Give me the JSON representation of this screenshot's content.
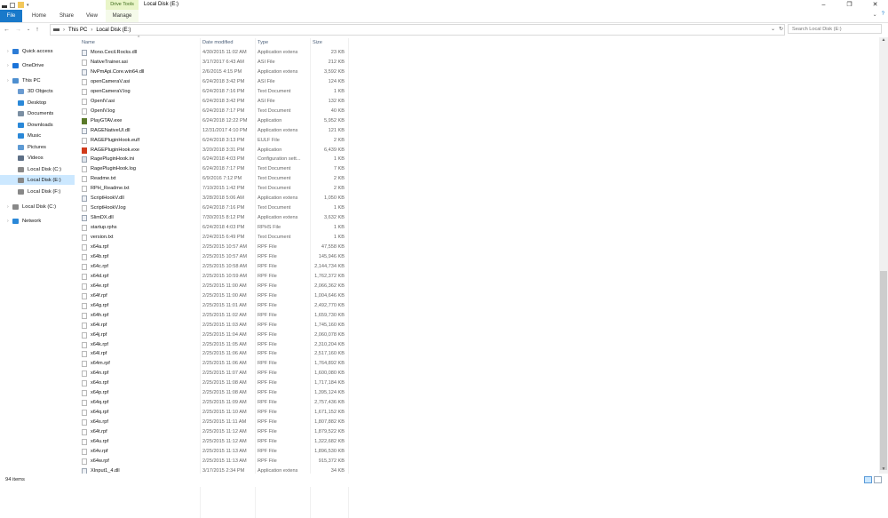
{
  "window": {
    "title": "Local Disk (E:)",
    "context_tab": "Drive Tools",
    "controls": [
      "–",
      "❐",
      "✕"
    ]
  },
  "ribbon": {
    "file": "File",
    "tabs": [
      "Home",
      "Share",
      "View"
    ],
    "manage": "Manage",
    "help": "?"
  },
  "address": {
    "crumbs": [
      "This PC",
      "Local Disk (E:)"
    ]
  },
  "search": {
    "placeholder": "Search Local Disk (E:)"
  },
  "sidebar": {
    "items": [
      {
        "label": "Quick access",
        "icon": "star-icon",
        "color": "#2c7cd6"
      },
      {
        "label": "OneDrive",
        "icon": "cloud-icon",
        "color": "#1a73d9"
      },
      {
        "label": "This PC",
        "icon": "computer-icon",
        "color": "#4d8fd0"
      },
      {
        "label": "3D Objects",
        "icon": "cube-icon",
        "color": "#6a9bd1"
      },
      {
        "label": "Desktop",
        "icon": "desktop-icon",
        "color": "#2a88d8"
      },
      {
        "label": "Documents",
        "icon": "documents-icon",
        "color": "#7b8fa3"
      },
      {
        "label": "Downloads",
        "icon": "download-icon",
        "color": "#2a88d8"
      },
      {
        "label": "Music",
        "icon": "music-icon",
        "color": "#2a88d8"
      },
      {
        "label": "Pictures",
        "icon": "pictures-icon",
        "color": "#5d9ad4"
      },
      {
        "label": "Videos",
        "icon": "videos-icon",
        "color": "#5d6f86"
      },
      {
        "label": "Local Disk (C:)",
        "icon": "drive-icon",
        "color": "#888888"
      },
      {
        "label": "Local Disk (E:)",
        "icon": "drive-icon",
        "color": "#888888"
      },
      {
        "label": "Local Disk (F:)",
        "icon": "drive-icon",
        "color": "#888888"
      },
      {
        "label": "Local Disk (C:)",
        "icon": "drive-icon",
        "color": "#888888"
      },
      {
        "label": "Network",
        "icon": "network-icon",
        "color": "#2a88d8"
      }
    ]
  },
  "columns": {
    "name": "Name",
    "date": "Date modified",
    "type": "Type",
    "size": "Size"
  },
  "files": [
    {
      "name": "Mono.Cecil.Rocks.dll",
      "date": "4/30/2015 11:02 AM",
      "type": "Application extens",
      "size": "23 KB",
      "icon": "dll"
    },
    {
      "name": "NativeTrainer.asi",
      "date": "3/17/2017 6:43 AM",
      "type": "ASI File",
      "size": "212 KB",
      "icon": "file"
    },
    {
      "name": "NvPmApi.Core.win64.dll",
      "date": "2/6/2015 4:15 PM",
      "type": "Application extens",
      "size": "3,592 KB",
      "icon": "dll"
    },
    {
      "name": "openCameraV.asi",
      "date": "6/24/2018 3:42 PM",
      "type": "ASI File",
      "size": "124 KB",
      "icon": "file"
    },
    {
      "name": "openCameraV.log",
      "date": "6/24/2018 7:16 PM",
      "type": "Text Document",
      "size": "1 KB",
      "icon": "file"
    },
    {
      "name": "OpenIV.asi",
      "date": "6/24/2018 3:42 PM",
      "type": "ASI File",
      "size": "132 KB",
      "icon": "file"
    },
    {
      "name": "OpenIV.log",
      "date": "6/24/2018 7:17 PM",
      "type": "Text Document",
      "size": "40 KB",
      "icon": "file"
    },
    {
      "name": "PlayGTAV.exe",
      "date": "6/24/2018 12:22 PM",
      "type": "Application",
      "size": "5,952 KB",
      "icon": "exe"
    },
    {
      "name": "RAGENativeUI.dll",
      "date": "12/31/2017 4:10 PM",
      "type": "Application extens",
      "size": "121 KB",
      "icon": "dll"
    },
    {
      "name": "RAGEPluginHook.eulf",
      "date": "6/24/2018 3:13 PM",
      "type": "EULF File",
      "size": "2 KB",
      "icon": "file"
    },
    {
      "name": "RAGEPluginHook.exe",
      "date": "3/20/2018 3:31 PM",
      "type": "Application",
      "size": "6,439 KB",
      "icon": "rage"
    },
    {
      "name": "RagePluginHook.ini",
      "date": "6/24/2018 4:03 PM",
      "type": "Configuration sett...",
      "size": "1 KB",
      "icon": "gear"
    },
    {
      "name": "RagePluginHook.log",
      "date": "6/24/2018 7:17 PM",
      "type": "Text Document",
      "size": "7 KB",
      "icon": "file"
    },
    {
      "name": "Readme.txt",
      "date": "6/9/2016 7:12 PM",
      "type": "Text Document",
      "size": "2 KB",
      "icon": "file"
    },
    {
      "name": "RPH_Readme.txt",
      "date": "7/10/2015 1:42 PM",
      "type": "Text Document",
      "size": "2 KB",
      "icon": "file"
    },
    {
      "name": "ScriptHookV.dll",
      "date": "3/28/2018 5:06 AM",
      "type": "Application extens",
      "size": "1,050 KB",
      "icon": "dll"
    },
    {
      "name": "ScriptHookV.log",
      "date": "6/24/2018 7:16 PM",
      "type": "Text Document",
      "size": "1 KB",
      "icon": "file"
    },
    {
      "name": "SlimDX.dll",
      "date": "7/30/2015 8:12 PM",
      "type": "Application extens",
      "size": "3,632 KB",
      "icon": "dll"
    },
    {
      "name": "startup.rphs",
      "date": "6/24/2018 4:03 PM",
      "type": "RPHS File",
      "size": "1 KB",
      "icon": "file"
    },
    {
      "name": "version.txt",
      "date": "2/24/2015 6:49 PM",
      "type": "Text Document",
      "size": "1 KB",
      "icon": "file"
    },
    {
      "name": "x64a.rpf",
      "date": "2/25/2015 10:57 AM",
      "type": "RPF File",
      "size": "47,558 KB",
      "icon": "file"
    },
    {
      "name": "x64b.rpf",
      "date": "2/25/2015 10:57 AM",
      "type": "RPF File",
      "size": "145,946 KB",
      "icon": "file"
    },
    {
      "name": "x64c.rpf",
      "date": "2/25/2015 10:58 AM",
      "type": "RPF File",
      "size": "2,144,734 KB",
      "icon": "file"
    },
    {
      "name": "x64d.rpf",
      "date": "2/25/2015 10:59 AM",
      "type": "RPF File",
      "size": "1,762,372 KB",
      "icon": "file"
    },
    {
      "name": "x64e.rpf",
      "date": "2/25/2015 11:00 AM",
      "type": "RPF File",
      "size": "2,066,362 KB",
      "icon": "file"
    },
    {
      "name": "x64f.rpf",
      "date": "2/25/2015 11:00 AM",
      "type": "RPF File",
      "size": "1,004,646 KB",
      "icon": "file"
    },
    {
      "name": "x64g.rpf",
      "date": "2/25/2015 11:01 AM",
      "type": "RPF File",
      "size": "2,492,770 KB",
      "icon": "file"
    },
    {
      "name": "x64h.rpf",
      "date": "2/25/2015 11:02 AM",
      "type": "RPF File",
      "size": "1,659,730 KB",
      "icon": "file"
    },
    {
      "name": "x64i.rpf",
      "date": "2/25/2015 11:03 AM",
      "type": "RPF File",
      "size": "1,745,160 KB",
      "icon": "file"
    },
    {
      "name": "x64j.rpf",
      "date": "2/25/2015 11:04 AM",
      "type": "RPF File",
      "size": "2,060,078 KB",
      "icon": "file"
    },
    {
      "name": "x64k.rpf",
      "date": "2/25/2015 11:05 AM",
      "type": "RPF File",
      "size": "2,310,204 KB",
      "icon": "file"
    },
    {
      "name": "x64l.rpf",
      "date": "2/25/2015 11:06 AM",
      "type": "RPF File",
      "size": "2,517,160 KB",
      "icon": "file"
    },
    {
      "name": "x64m.rpf",
      "date": "2/25/2015 11:06 AM",
      "type": "RPF File",
      "size": "1,764,892 KB",
      "icon": "file"
    },
    {
      "name": "x64n.rpf",
      "date": "2/25/2015 11:07 AM",
      "type": "RPF File",
      "size": "1,600,080 KB",
      "icon": "file"
    },
    {
      "name": "x64o.rpf",
      "date": "2/25/2015 11:08 AM",
      "type": "RPF File",
      "size": "1,717,184 KB",
      "icon": "file"
    },
    {
      "name": "x64p.rpf",
      "date": "2/25/2015 11:08 AM",
      "type": "RPF File",
      "size": "1,395,124 KB",
      "icon": "file"
    },
    {
      "name": "x64q.rpf",
      "date": "2/25/2015 11:09 AM",
      "type": "RPF File",
      "size": "2,757,436 KB",
      "icon": "file"
    },
    {
      "name": "x64q.rpf",
      "date": "2/25/2015 11:10 AM",
      "type": "RPF File",
      "size": "1,671,152 KB",
      "icon": "file"
    },
    {
      "name": "x64s.rpf",
      "date": "2/25/2015 11:11 AM",
      "type": "RPF File",
      "size": "1,807,882 KB",
      "icon": "file"
    },
    {
      "name": "x64t.rpf",
      "date": "2/25/2015 11:12 AM",
      "type": "RPF File",
      "size": "1,879,522 KB",
      "icon": "file"
    },
    {
      "name": "x64u.rpf",
      "date": "2/25/2015 11:12 AM",
      "type": "RPF File",
      "size": "1,322,682 KB",
      "icon": "file"
    },
    {
      "name": "x64v.rpf",
      "date": "2/25/2015 11:13 AM",
      "type": "RPF File",
      "size": "1,896,530 KB",
      "icon": "file"
    },
    {
      "name": "x64w.rpf",
      "date": "2/25/2015 11:13 AM",
      "type": "RPF File",
      "size": "915,372 KB",
      "icon": "file"
    },
    {
      "name": "XInput1_4.dll",
      "date": "3/17/2015 2:34 PM",
      "type": "Application extens",
      "size": "34 KB",
      "icon": "dll"
    }
  ],
  "status": {
    "count": "94 items"
  }
}
